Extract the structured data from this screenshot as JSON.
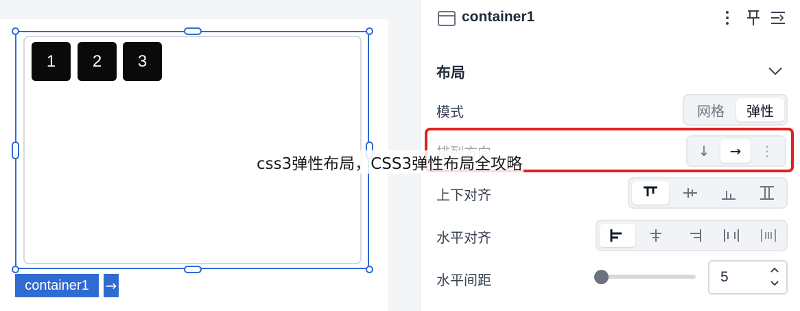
{
  "canvas": {
    "items": [
      "1",
      "2",
      "3"
    ],
    "selection_label": "container1",
    "selection_arrow": "→"
  },
  "panel": {
    "component_name": "container1",
    "header_icons": [
      "more-vertical-icon",
      "pin-icon",
      "collapse-panel-icon"
    ],
    "section_title": "布局",
    "mode": {
      "label": "模式",
      "options": [
        "网格",
        "弹性"
      ],
      "selected": "弹性"
    },
    "direction": {
      "label": "排列方向",
      "options": [
        "↓",
        "→",
        "⋮"
      ],
      "selected": "→"
    },
    "vertical_align": {
      "label": "上下对齐"
    },
    "horizontal_align": {
      "label": "水平对齐"
    },
    "horizontal_gap": {
      "label": "水平间距",
      "value": "5"
    }
  },
  "overlay_caption": "css3弹性布局，CSS3弹性布局全攻略",
  "colors": {
    "selection": "#2f6bd1",
    "highlight": "#e02020"
  }
}
